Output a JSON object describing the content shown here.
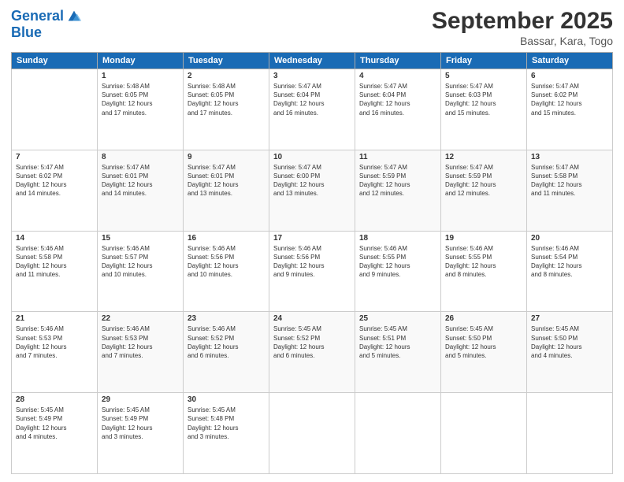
{
  "logo": {
    "line1": "General",
    "line2": "Blue"
  },
  "title": "September 2025",
  "location": "Bassar, Kara, Togo",
  "days_of_week": [
    "Sunday",
    "Monday",
    "Tuesday",
    "Wednesday",
    "Thursday",
    "Friday",
    "Saturday"
  ],
  "weeks": [
    [
      {
        "day": "",
        "content": ""
      },
      {
        "day": "1",
        "content": "Sunrise: 5:48 AM\nSunset: 6:05 PM\nDaylight: 12 hours\nand 17 minutes."
      },
      {
        "day": "2",
        "content": "Sunrise: 5:48 AM\nSunset: 6:05 PM\nDaylight: 12 hours\nand 17 minutes."
      },
      {
        "day": "3",
        "content": "Sunrise: 5:47 AM\nSunset: 6:04 PM\nDaylight: 12 hours\nand 16 minutes."
      },
      {
        "day": "4",
        "content": "Sunrise: 5:47 AM\nSunset: 6:04 PM\nDaylight: 12 hours\nand 16 minutes."
      },
      {
        "day": "5",
        "content": "Sunrise: 5:47 AM\nSunset: 6:03 PM\nDaylight: 12 hours\nand 15 minutes."
      },
      {
        "day": "6",
        "content": "Sunrise: 5:47 AM\nSunset: 6:02 PM\nDaylight: 12 hours\nand 15 minutes."
      }
    ],
    [
      {
        "day": "7",
        "content": "Sunrise: 5:47 AM\nSunset: 6:02 PM\nDaylight: 12 hours\nand 14 minutes."
      },
      {
        "day": "8",
        "content": "Sunrise: 5:47 AM\nSunset: 6:01 PM\nDaylight: 12 hours\nand 14 minutes."
      },
      {
        "day": "9",
        "content": "Sunrise: 5:47 AM\nSunset: 6:01 PM\nDaylight: 12 hours\nand 13 minutes."
      },
      {
        "day": "10",
        "content": "Sunrise: 5:47 AM\nSunset: 6:00 PM\nDaylight: 12 hours\nand 13 minutes."
      },
      {
        "day": "11",
        "content": "Sunrise: 5:47 AM\nSunset: 5:59 PM\nDaylight: 12 hours\nand 12 minutes."
      },
      {
        "day": "12",
        "content": "Sunrise: 5:47 AM\nSunset: 5:59 PM\nDaylight: 12 hours\nand 12 minutes."
      },
      {
        "day": "13",
        "content": "Sunrise: 5:47 AM\nSunset: 5:58 PM\nDaylight: 12 hours\nand 11 minutes."
      }
    ],
    [
      {
        "day": "14",
        "content": "Sunrise: 5:46 AM\nSunset: 5:58 PM\nDaylight: 12 hours\nand 11 minutes."
      },
      {
        "day": "15",
        "content": "Sunrise: 5:46 AM\nSunset: 5:57 PM\nDaylight: 12 hours\nand 10 minutes."
      },
      {
        "day": "16",
        "content": "Sunrise: 5:46 AM\nSunset: 5:56 PM\nDaylight: 12 hours\nand 10 minutes."
      },
      {
        "day": "17",
        "content": "Sunrise: 5:46 AM\nSunset: 5:56 PM\nDaylight: 12 hours\nand 9 minutes."
      },
      {
        "day": "18",
        "content": "Sunrise: 5:46 AM\nSunset: 5:55 PM\nDaylight: 12 hours\nand 9 minutes."
      },
      {
        "day": "19",
        "content": "Sunrise: 5:46 AM\nSunset: 5:55 PM\nDaylight: 12 hours\nand 8 minutes."
      },
      {
        "day": "20",
        "content": "Sunrise: 5:46 AM\nSunset: 5:54 PM\nDaylight: 12 hours\nand 8 minutes."
      }
    ],
    [
      {
        "day": "21",
        "content": "Sunrise: 5:46 AM\nSunset: 5:53 PM\nDaylight: 12 hours\nand 7 minutes."
      },
      {
        "day": "22",
        "content": "Sunrise: 5:46 AM\nSunset: 5:53 PM\nDaylight: 12 hours\nand 7 minutes."
      },
      {
        "day": "23",
        "content": "Sunrise: 5:46 AM\nSunset: 5:52 PM\nDaylight: 12 hours\nand 6 minutes."
      },
      {
        "day": "24",
        "content": "Sunrise: 5:45 AM\nSunset: 5:52 PM\nDaylight: 12 hours\nand 6 minutes."
      },
      {
        "day": "25",
        "content": "Sunrise: 5:45 AM\nSunset: 5:51 PM\nDaylight: 12 hours\nand 5 minutes."
      },
      {
        "day": "26",
        "content": "Sunrise: 5:45 AM\nSunset: 5:50 PM\nDaylight: 12 hours\nand 5 minutes."
      },
      {
        "day": "27",
        "content": "Sunrise: 5:45 AM\nSunset: 5:50 PM\nDaylight: 12 hours\nand 4 minutes."
      }
    ],
    [
      {
        "day": "28",
        "content": "Sunrise: 5:45 AM\nSunset: 5:49 PM\nDaylight: 12 hours\nand 4 minutes."
      },
      {
        "day": "29",
        "content": "Sunrise: 5:45 AM\nSunset: 5:49 PM\nDaylight: 12 hours\nand 3 minutes."
      },
      {
        "day": "30",
        "content": "Sunrise: 5:45 AM\nSunset: 5:48 PM\nDaylight: 12 hours\nand 3 minutes."
      },
      {
        "day": "",
        "content": ""
      },
      {
        "day": "",
        "content": ""
      },
      {
        "day": "",
        "content": ""
      },
      {
        "day": "",
        "content": ""
      }
    ]
  ]
}
